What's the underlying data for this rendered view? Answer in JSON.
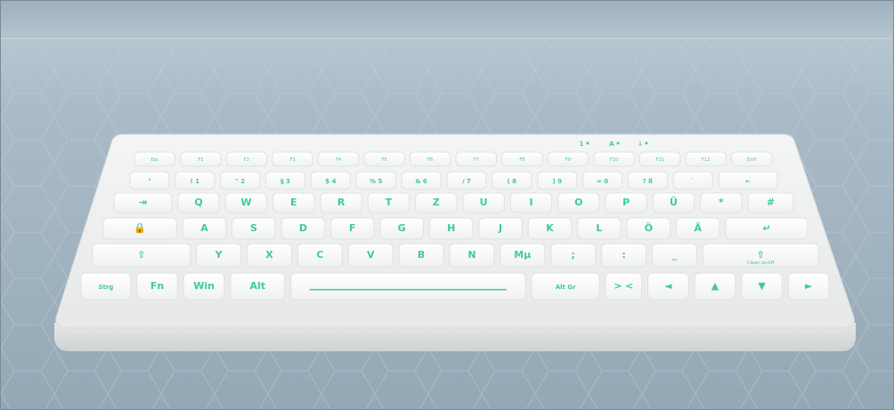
{
  "image": {
    "subject": "white silicone keyboard with green backlit legends",
    "colors": {
      "background": "#a9bbc7",
      "keyboard_body": "#eeefef",
      "key_face": "#f9f9f9",
      "legend": "#3ec9a5"
    }
  },
  "keyboard": {
    "indicator_row": [
      "1",
      "A",
      "↓"
    ],
    "rows": [
      [
        "Esc",
        "F1",
        "F2",
        "F3",
        "F4",
        "F5",
        "F6",
        "F7",
        "F8",
        "F9",
        "F10",
        "F11",
        "F12",
        "Entf"
      ],
      [
        "°",
        "! 1",
        "\" 2",
        "§ 3",
        "$ 4",
        "% 5",
        "& 6",
        "/ 7",
        "( 8",
        ") 9",
        "= 0",
        "? ß",
        "`",
        "←"
      ],
      [
        "⇥",
        "Q",
        "W",
        "E",
        "R",
        "T",
        "Z",
        "U",
        "I",
        "O",
        "P",
        "Ü",
        "*",
        "#"
      ],
      [
        "🔒",
        "A",
        "S",
        "D",
        "F",
        "G",
        "H",
        "J",
        "K",
        "L",
        "Ö",
        "Ä",
        "↵"
      ],
      [
        "⇧",
        "Y",
        "X",
        "C",
        "V",
        "B",
        "N",
        "Mµ",
        ";",
        ":",
        "_",
        "⇧"
      ],
      [
        "Strg",
        "Fn",
        "Win",
        "Alt",
        "",
        "Alt Gr",
        "> <",
        "◄",
        "▲",
        "▼",
        "►"
      ]
    ],
    "special_labels": {
      "clean": "Clean on/off"
    }
  }
}
